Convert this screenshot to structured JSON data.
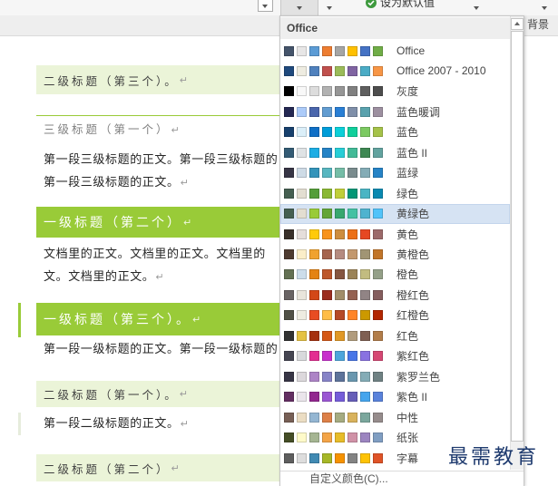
{
  "ribbon": {
    "set_default_label": "设为默认值",
    "group_label": "背景"
  },
  "icons": {
    "dropdown": "chevron-down-icon",
    "set_default": "check-circle-icon",
    "scroll_up": "scroll-up-arrow-icon"
  },
  "document": {
    "paragraph_mark": "↵",
    "heading2_third": "二级标题（第三个）。",
    "heading3_first": "三级标题（第一个）",
    "body_h3_line1": "第一段三级标题的正文。第一段三级标题的",
    "body_h3_line2": "第一段三级标题的正文。",
    "heading1_second": "一级标题（第二个）",
    "body_doc_line1": "文档里的正文。文档里的正文。文档里的",
    "body_doc_line2": "文。文档里的正文。",
    "heading1_third": "一级标题（第三个）。",
    "body_h1_line1": "第一段一级标题的正文。第一段一级标题的",
    "heading2_first": "二级标题（第一个）。",
    "body_h2_line1": "第一段二级标题的正文。",
    "heading2_second": "二级标题（第二个）"
  },
  "color_menu": {
    "header": "Office",
    "schemes": [
      {
        "name": "Office",
        "colors": [
          "#44546A",
          "#E7E6E6",
          "#5B9BD5",
          "#ED7D31",
          "#A5A5A5",
          "#FFC000",
          "#4472C4",
          "#70AD47"
        ]
      },
      {
        "name": "Office 2007 - 2010",
        "colors": [
          "#1F497D",
          "#EEECE1",
          "#4F81BD",
          "#C0504D",
          "#9BBB59",
          "#8064A2",
          "#4BACC6",
          "#F79646"
        ]
      },
      {
        "name": "灰度",
        "colors": [
          "#000000",
          "#F8F8F8",
          "#DDDDDD",
          "#B2B2B2",
          "#969696",
          "#808080",
          "#5F5F5F",
          "#4D4D4D"
        ]
      },
      {
        "name": "蓝色暖调",
        "colors": [
          "#242852",
          "#ACCBF9",
          "#4A66AC",
          "#629DD1",
          "#297FD5",
          "#7F8FA9",
          "#5AA2AE",
          "#9D90A0"
        ]
      },
      {
        "name": "蓝色",
        "colors": [
          "#17406D",
          "#DBEFF9",
          "#0F6FC6",
          "#009DD9",
          "#0BD0D9",
          "#10CF9B",
          "#7CCA62",
          "#A5C249"
        ]
      },
      {
        "name": "蓝色 II",
        "colors": [
          "#335B74",
          "#DFE3E5",
          "#1CADE4",
          "#2683C6",
          "#27CED7",
          "#42BA97",
          "#3E8853",
          "#62A39F"
        ]
      },
      {
        "name": "蓝绿",
        "colors": [
          "#373545",
          "#CEDBE6",
          "#3494BA",
          "#58B6C0",
          "#75BDA7",
          "#7A8C8E",
          "#84ACB6",
          "#2683C6"
        ]
      },
      {
        "name": "绿色",
        "colors": [
          "#455F51",
          "#E3DED1",
          "#549E39",
          "#8AB833",
          "#C0CF3A",
          "#029676",
          "#4AB5C4",
          "#0989B1"
        ]
      },
      {
        "name": "黄绿色",
        "highlighted": true,
        "colors": [
          "#455F51",
          "#E3DED1",
          "#99CB38",
          "#63A537",
          "#37A76F",
          "#44C1A3",
          "#4EB3CF",
          "#51C3F9"
        ]
      },
      {
        "name": "黄色",
        "colors": [
          "#39302A",
          "#E5DEDB",
          "#FFCA08",
          "#F8931D",
          "#CE8D3E",
          "#EC7016",
          "#E64823",
          "#9C6A6A"
        ]
      },
      {
        "name": "黄橙色",
        "colors": [
          "#4E3B30",
          "#FBEEC9",
          "#F0A22E",
          "#A5644E",
          "#B58B80",
          "#C3986D",
          "#A19574",
          "#C17529"
        ]
      },
      {
        "name": "橙色",
        "colors": [
          "#637052",
          "#CCDDEA",
          "#E48312",
          "#BD582C",
          "#865640",
          "#9B8357",
          "#C2BC80",
          "#94A088"
        ]
      },
      {
        "name": "橙红色",
        "colors": [
          "#696464",
          "#E9E5DC",
          "#D34817",
          "#9B2D1F",
          "#A28E6A",
          "#956251",
          "#918485",
          "#855D5D"
        ]
      },
      {
        "name": "红橙色",
        "colors": [
          "#505046",
          "#EEECE1",
          "#E84C22",
          "#FFBD47",
          "#B64926",
          "#FF8427",
          "#CC9900",
          "#B22600"
        ]
      },
      {
        "name": "红色",
        "colors": [
          "#323232",
          "#E5C243",
          "#A5300F",
          "#D55816",
          "#E19825",
          "#B19C7D",
          "#7F5F52",
          "#B27D49"
        ]
      },
      {
        "name": "紫红色",
        "colors": [
          "#454551",
          "#D8D9DC",
          "#E32D91",
          "#C830CC",
          "#4EA6DC",
          "#4775E7",
          "#8971E1",
          "#D54773"
        ]
      },
      {
        "name": "紫罗兰色",
        "colors": [
          "#373545",
          "#DCD8DC",
          "#AD84C6",
          "#8784C7",
          "#5D739A",
          "#6997AF",
          "#84ACB6",
          "#6F8183"
        ]
      },
      {
        "name": "紫色 II",
        "colors": [
          "#632E62",
          "#EAE5EB",
          "#92278F",
          "#9B57D3",
          "#755DD9",
          "#665EB8",
          "#45A5ED",
          "#5982DB"
        ]
      },
      {
        "name": "中性",
        "colors": [
          "#775F55",
          "#EBDDC3",
          "#94B6D2",
          "#DD8047",
          "#A5AB81",
          "#D8B25C",
          "#7BA79D",
          "#968C8C"
        ]
      },
      {
        "name": "纸张",
        "colors": [
          "#444D26",
          "#FEFAC9",
          "#A5B592",
          "#F3A447",
          "#E7BC29",
          "#D092A7",
          "#9C85C0",
          "#809EC2"
        ]
      },
      {
        "name": "字幕",
        "colors": [
          "#5E5E5E",
          "#DDDDDD",
          "#418AB3",
          "#A6B727",
          "#F69200",
          "#838383",
          "#FEC306",
          "#DF5327"
        ]
      }
    ],
    "custom_colors_label": "自定义颜色(C)..."
  },
  "watermark": "最需教育",
  "colors": {
    "heading1_bg": "#99CB38",
    "heading2_bg": "#EBF4D8",
    "heading3_rule": "#99CB38",
    "heading3_text": "#808080",
    "hover_bg": "#D6E3F3",
    "hover_border": "#C3D5EC",
    "check_green": "#3E9A3E",
    "watermark": "#1E3A6E"
  }
}
